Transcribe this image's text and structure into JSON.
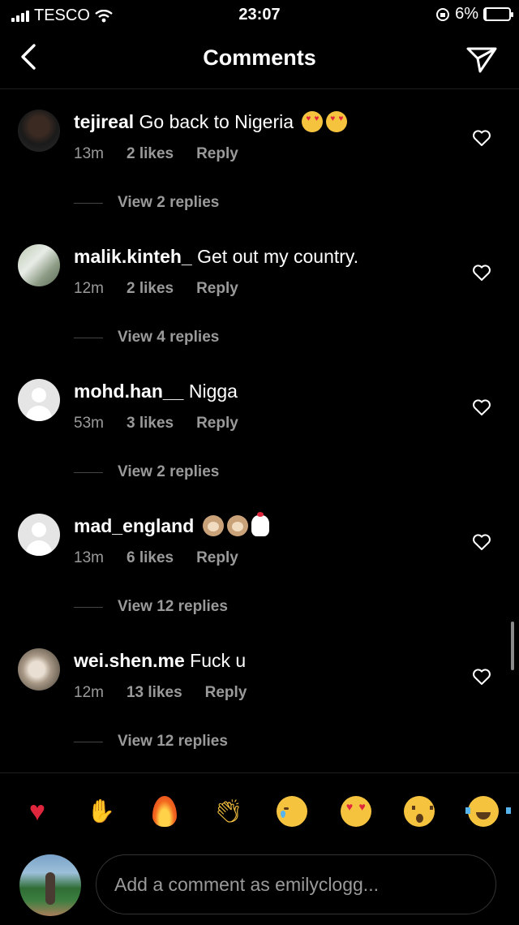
{
  "status_bar": {
    "carrier": "TESCO",
    "time": "23:07",
    "battery": "6%",
    "battery_level": 0.06
  },
  "header": {
    "title": "Comments",
    "back_icon": "chevron-left-icon",
    "send_icon": "paper-plane-icon"
  },
  "comments": [
    {
      "username": "tejireal",
      "text": "Go back to Nigeria",
      "emojis": [
        "heart-eyes",
        "heart-eyes"
      ],
      "time": "13m",
      "likes": "2 likes",
      "reply": "Reply",
      "view_replies": "View 2 replies"
    },
    {
      "username": "malik.kinteh_",
      "text": "Get out my country.",
      "emojis": [],
      "time": "12m",
      "likes": "2 likes",
      "reply": "Reply",
      "view_replies": "View 4 replies"
    },
    {
      "username": "mohd.han__",
      "text": "Nigga",
      "emojis": [],
      "time": "53m",
      "likes": "3 likes",
      "reply": "Reply",
      "view_replies": "View 2 replies"
    },
    {
      "username": "mad_england",
      "text": "",
      "emojis": [
        "monkey",
        "monkey",
        "chicken"
      ],
      "time": "13m",
      "likes": "6 likes",
      "reply": "Reply",
      "view_replies": "View 12 replies"
    },
    {
      "username": "wei.shen.me",
      "text": "Fuck u",
      "emojis": [],
      "time": "12m",
      "likes": "13 likes",
      "reply": "Reply",
      "view_replies": "View 12 replies"
    }
  ],
  "emoji_bar": [
    "red-heart",
    "raising-hands",
    "fire",
    "clapping-hands",
    "crying-face",
    "heart-eyes-face",
    "open-mouth-face",
    "tears-of-joy-face"
  ],
  "comment_input": {
    "placeholder": "Add a comment as emilyclogg..."
  },
  "colors": {
    "background": "#000000",
    "secondary_text": "#9a9a9a",
    "divider": "#1e1e1e"
  }
}
